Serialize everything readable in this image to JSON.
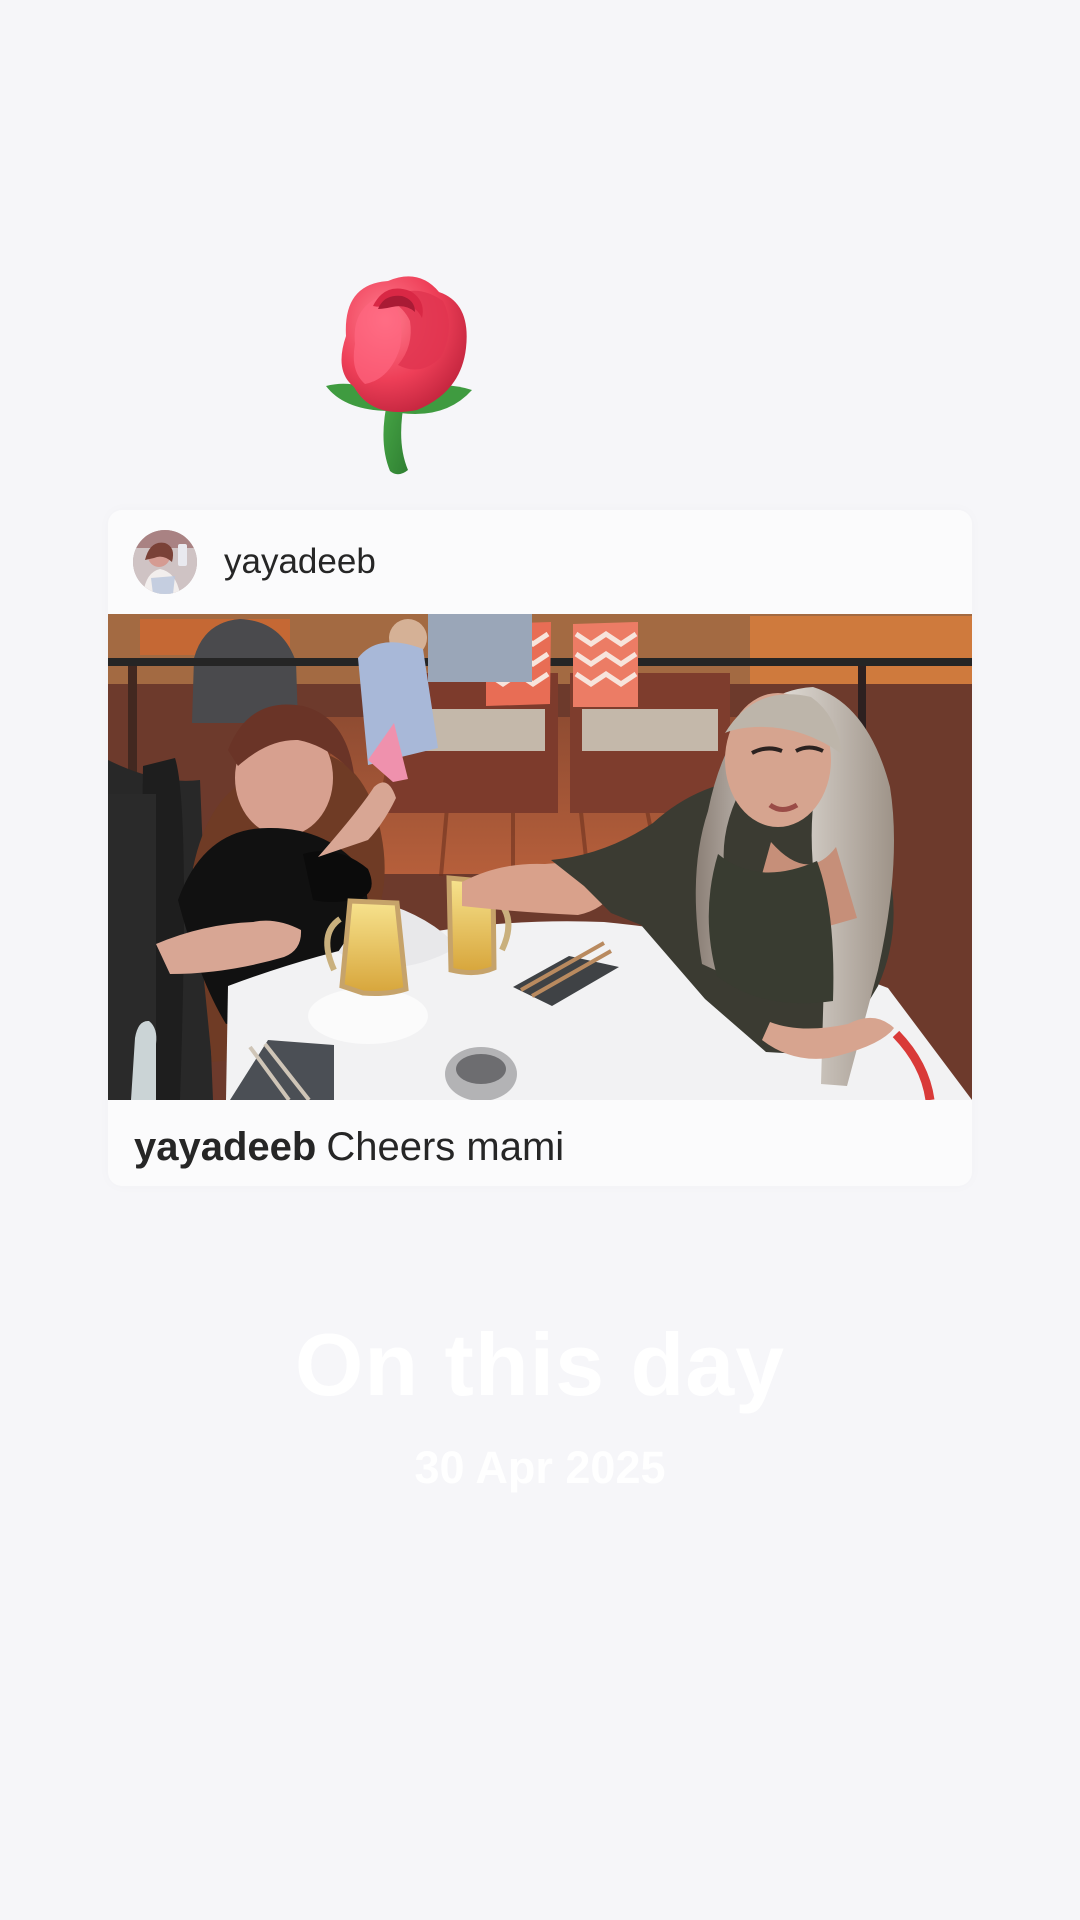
{
  "sticker": {
    "icon": "rose-icon"
  },
  "post": {
    "username": "yayadeeb",
    "avatar_icon": "profile-avatar",
    "photo_icon": "photo-two-women-cheers",
    "caption_user": "yayadeeb",
    "caption_text": "Cheers mami"
  },
  "memory": {
    "title": "On this day",
    "date": "30 Apr 2025"
  },
  "colors": {
    "background": "#f6f6f9",
    "card": "#fbfbfc",
    "text": "#262626",
    "overlay_text": "#ffffff"
  }
}
